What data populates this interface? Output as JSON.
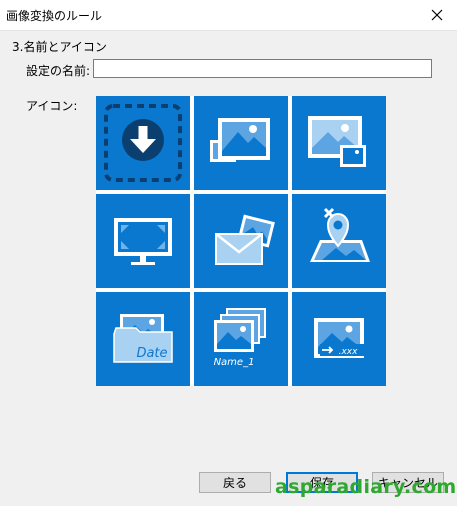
{
  "window": {
    "title": "画像変換のルール"
  },
  "section_heading": "3.名前とアイコン",
  "name_field": {
    "label": "設定の名前:",
    "value": ""
  },
  "icon_label": "アイコン:",
  "tiles": [
    {
      "icon": "download-arrow-icon"
    },
    {
      "icon": "image-convert-icon"
    },
    {
      "icon": "image-resize-icon"
    },
    {
      "icon": "monitor-fit-icon"
    },
    {
      "icon": "mail-image-icon"
    },
    {
      "icon": "map-pin-remove-icon"
    },
    {
      "icon": "date-folder-icon",
      "text": "Date"
    },
    {
      "icon": "rename-stack-icon",
      "text": "Name_1"
    },
    {
      "icon": "extension-convert-icon",
      "text": ".xxx"
    }
  ],
  "buttons": {
    "back": "戻る",
    "save": "保存",
    "cancel": "キャンセル"
  },
  "watermark": "asparadiary.com",
  "colors": {
    "tile": "#0b78d0",
    "accent": "#0078d7",
    "watermark": "#2ea82e"
  }
}
